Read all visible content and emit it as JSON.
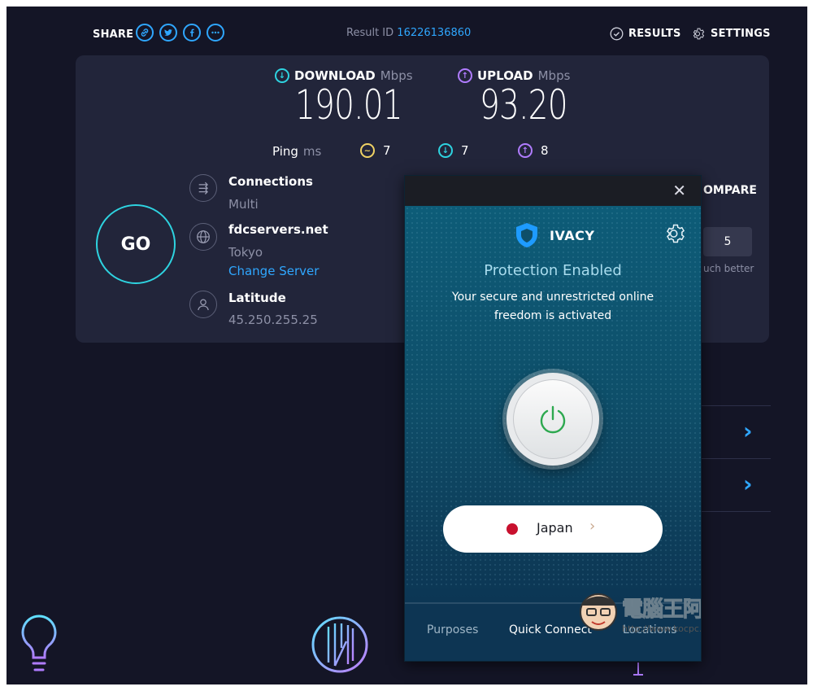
{
  "topbar": {
    "share_label": "SHARE",
    "result_label": "Result ID",
    "result_id": "16226136860",
    "results_label": "RESULTS",
    "settings_label": "SETTINGS"
  },
  "metrics": {
    "download_label": "DOWNLOAD",
    "download_unit": "Mbps",
    "download_value": "190.01",
    "upload_label": "UPLOAD",
    "upload_unit": "Mbps",
    "upload_value": "93.20",
    "ping_label": "Ping",
    "ping_unit": "ms",
    "ping_idle": "7",
    "ping_download": "7",
    "ping_upload": "8"
  },
  "go_label": "GO",
  "connections": {
    "label": "Connections",
    "value": "Multi"
  },
  "server": {
    "label": "fdcservers.net",
    "location": "Tokyo",
    "change_label": "Change Server"
  },
  "provider": {
    "label": "Latitude",
    "ip": "45.250.255.25"
  },
  "compare": {
    "label": "OMPARE",
    "rating": "5",
    "hint": "uch better"
  },
  "vpn": {
    "brand": "IVACY",
    "status": "Protection Enabled",
    "message_line1": "Your secure and unrestricted online",
    "message_line2": "freedom is activated",
    "country": "Japan",
    "nav": [
      "Purposes",
      "Quick Connect",
      "Locations"
    ],
    "watermark": "電腦王阿達",
    "watermark_url": "http://www.kocpc.com.tw"
  },
  "colors": {
    "background": "#141526",
    "card": "#22253a",
    "accent_blue": "#2fa7ff",
    "go_ring": "#2ed3e0",
    "upload_purple": "#b07cff",
    "ping_yellow": "#f0d264",
    "power_green": "#2da84f",
    "japan_red": "#c8102e"
  }
}
